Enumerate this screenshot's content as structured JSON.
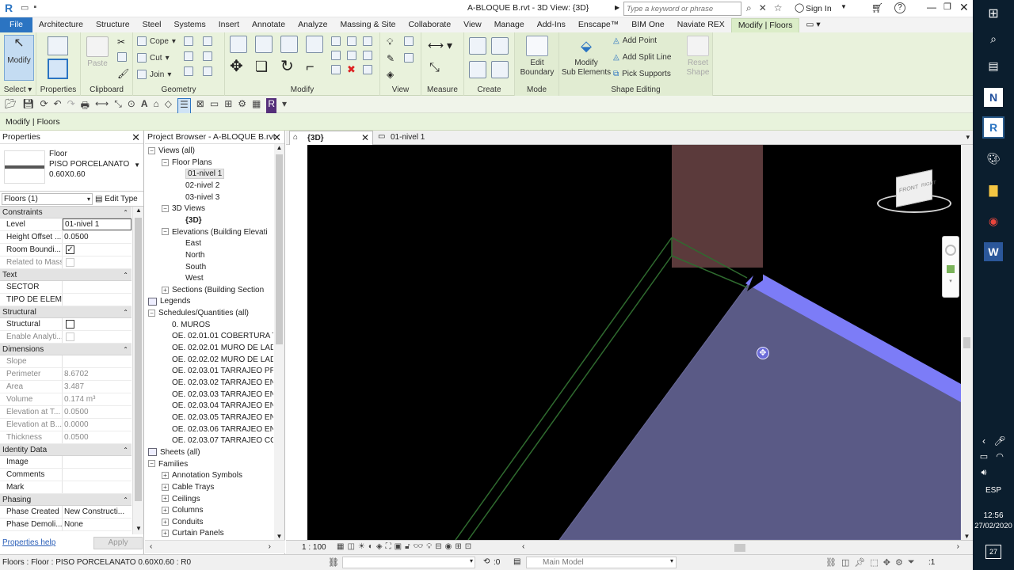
{
  "titlebar": {
    "title": "A-BLOQUE B.rvt - 3D View: {3D}",
    "search_placeholder": "Type a keyword or phrase",
    "sign_in": "Sign In",
    "app_letter": "R"
  },
  "tabs": [
    "File",
    "Architecture",
    "Structure",
    "Steel",
    "Systems",
    "Insert",
    "Annotate",
    "Analyze",
    "Massing & Site",
    "Collaborate",
    "View",
    "Manage",
    "Add-Ins",
    "Enscape™",
    "BIM One",
    "Naviate REX",
    "Modify | Floors"
  ],
  "ribbon": {
    "modify_label": "Modify",
    "select_label": "Select",
    "properties_label": "Properties",
    "paste_label": "Paste",
    "clipboard_label": "Clipboard",
    "cope_label": "Cope",
    "cut_label": "Cut",
    "join_label": "Join",
    "geometry_label": "Geometry",
    "modify_group_label": "Modify",
    "view_label": "View",
    "measure_label": "Measure",
    "create_label": "Create",
    "edit_boundary_1": "Edit",
    "edit_boundary_2": "Boundary",
    "mode_label": "Mode",
    "modify_sub_1": "Modify",
    "modify_sub_2": "Sub Elements",
    "add_point": "Add Point",
    "add_split_line": "Add Split Line",
    "pick_supports": "Pick Supports",
    "reset_shape_1": "Reset",
    "reset_shape_2": "Shape",
    "shape_editing_label": "Shape Editing"
  },
  "modbar": {
    "text": "Modify | Floors"
  },
  "properties": {
    "title": "Properties",
    "family": "Floor",
    "type": "PISO PORCELANATO",
    "size": "0.60X0.60",
    "selector": "Floors (1)",
    "edit_type": "Edit Type",
    "help": "Properties help",
    "apply": "Apply",
    "sections": [
      {
        "name": "Constraints",
        "rows": [
          {
            "k": "Level",
            "v": "01-nivel 1",
            "box": true
          },
          {
            "k": "Height Offset ...",
            "v": "0.0500"
          },
          {
            "k": "Room Boundi...",
            "v": "",
            "check": true
          },
          {
            "k": "Related to Mass",
            "v": "",
            "check": false,
            "dis": true
          }
        ]
      },
      {
        "name": "Text",
        "rows": [
          {
            "k": "SECTOR",
            "v": ""
          },
          {
            "k": "TIPO DE ELEM...",
            "v": ""
          }
        ]
      },
      {
        "name": "Structural",
        "rows": [
          {
            "k": "Structural",
            "v": "",
            "check": false
          },
          {
            "k": "Enable Analyti...",
            "v": "",
            "check": false,
            "dis": true
          }
        ]
      },
      {
        "name": "Dimensions",
        "rows": [
          {
            "k": "Slope",
            "v": "",
            "dis": true
          },
          {
            "k": "Perimeter",
            "v": "8.6702",
            "dis": true
          },
          {
            "k": "Area",
            "v": "3.487",
            "dis": true
          },
          {
            "k": "Volume",
            "v": "0.174 m³",
            "dis": true
          },
          {
            "k": "Elevation at T...",
            "v": "0.0500",
            "dis": true
          },
          {
            "k": "Elevation at B...",
            "v": "0.0000",
            "dis": true
          },
          {
            "k": "Thickness",
            "v": "0.0500",
            "dis": true
          }
        ]
      },
      {
        "name": "Identity Data",
        "rows": [
          {
            "k": "Image",
            "v": ""
          },
          {
            "k": "Comments",
            "v": ""
          },
          {
            "k": "Mark",
            "v": ""
          }
        ]
      },
      {
        "name": "Phasing",
        "rows": [
          {
            "k": "Phase Created",
            "v": "New Constructi..."
          },
          {
            "k": "Phase Demoli...",
            "v": "None"
          }
        ]
      }
    ]
  },
  "browser": {
    "title": "Project Browser - A-BLOQUE B.rvt",
    "nodes": [
      {
        "label": "Views (all)",
        "lvl": 0,
        "tog": "-"
      },
      {
        "label": "Floor Plans",
        "lvl": 1,
        "tog": "-"
      },
      {
        "label": "01-nivel 1",
        "lvl": 2,
        "sel": true
      },
      {
        "label": "02-nivel 2",
        "lvl": 2
      },
      {
        "label": "03-nivel 3",
        "lvl": 2
      },
      {
        "label": "3D Views",
        "lvl": 1,
        "tog": "-"
      },
      {
        "label": "{3D}",
        "lvl": 2,
        "bold": true
      },
      {
        "label": "Elevations (Building Elevati",
        "lvl": 1,
        "tog": "-"
      },
      {
        "label": "East",
        "lvl": 2
      },
      {
        "label": "North",
        "lvl": 2
      },
      {
        "label": "South",
        "lvl": 2
      },
      {
        "label": "West",
        "lvl": 2
      },
      {
        "label": "Sections (Building Section",
        "lvl": 1,
        "tog": "+"
      },
      {
        "label": "Legends",
        "lvl": 0
      },
      {
        "label": "Schedules/Quantities (all)",
        "lvl": 0,
        "tog": "-"
      },
      {
        "label": "0. MUROS",
        "lvl": 1
      },
      {
        "label": "OE. 02.01.01 COBERTURA TE",
        "lvl": 1
      },
      {
        "label": "OE. 02.02.01 MURO DE LAD",
        "lvl": 1
      },
      {
        "label": "OE. 02.02.02 MURO DE LAD",
        "lvl": 1
      },
      {
        "label": "OE. 02.03.01 TARRAJEO PRI",
        "lvl": 1
      },
      {
        "label": "OE. 02.03.02 TARRAJEO EN",
        "lvl": 1
      },
      {
        "label": "OE. 02.03.03 TARRAJEO EN",
        "lvl": 1
      },
      {
        "label": "OE. 02.03.04 TARRAJEO EN",
        "lvl": 1
      },
      {
        "label": "OE. 02.03.05 TARRAJEO EN",
        "lvl": 1
      },
      {
        "label": "OE. 02.03.06 TARRAJEO EN",
        "lvl": 1
      },
      {
        "label": "OE. 02.03.07 TARRAJEO CON",
        "lvl": 1
      },
      {
        "label": "Sheets (all)",
        "lvl": 0
      },
      {
        "label": "Families",
        "lvl": 0,
        "tog": "-"
      },
      {
        "label": "Annotation Symbols",
        "lvl": 1,
        "tog": "+"
      },
      {
        "label": "Cable Trays",
        "lvl": 1,
        "tog": "+"
      },
      {
        "label": "Ceilings",
        "lvl": 1,
        "tog": "+"
      },
      {
        "label": "Columns",
        "lvl": 1,
        "tog": "+"
      },
      {
        "label": "Conduits",
        "lvl": 1,
        "tog": "+"
      },
      {
        "label": "Curtain Panels",
        "lvl": 1,
        "tog": "+"
      }
    ]
  },
  "viewtabs": {
    "active": "{3D}",
    "other": "01-nivel 1"
  },
  "viewcube": {
    "front": "FRONT",
    "right": "RIGHT"
  },
  "viewctl": {
    "scale": "1 : 100"
  },
  "status": {
    "text": "Floors : Floor : PISO PORCELANATO 0.60X0.60 : R0",
    "zero": ":0",
    "model": "Main Model",
    "filter": ":1"
  },
  "taskbar": {
    "lang": "ESP",
    "time": "12:56",
    "date": "27/02/2020",
    "notif": "27"
  }
}
